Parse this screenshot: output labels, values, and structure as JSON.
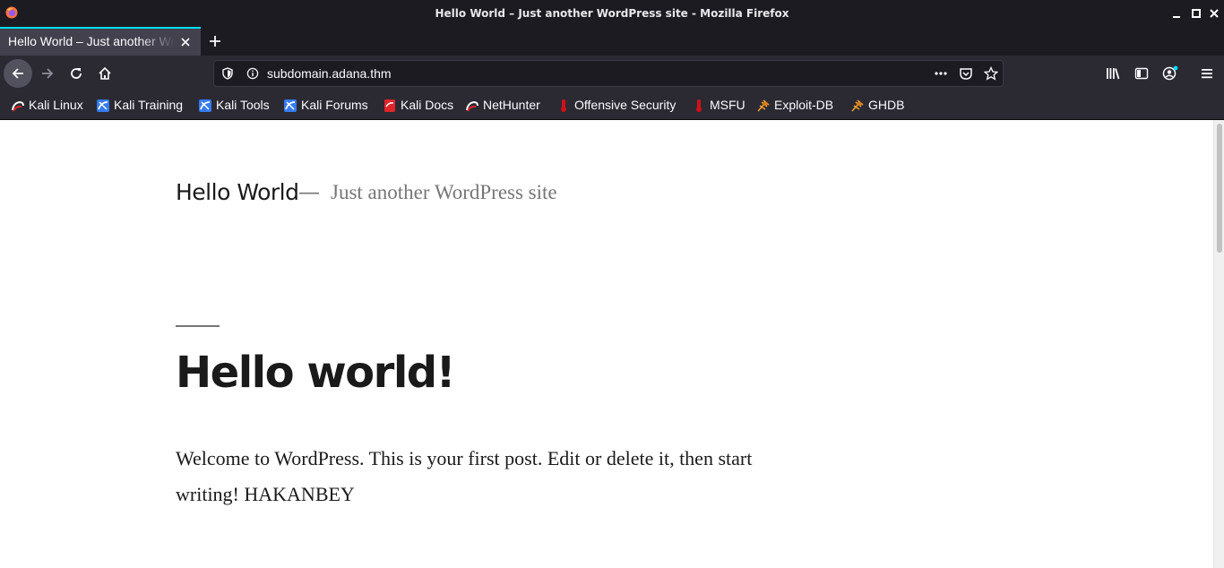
{
  "window": {
    "title": "Hello World – Just another WordPress site - Mozilla Firefox"
  },
  "tab": {
    "label": "Hello World – Just another WordPress site"
  },
  "urlbar": {
    "url": "subdomain.adana.thm"
  },
  "bookmarks": [
    {
      "label": "Kali Linux",
      "icon": "kali-dragon-icon"
    },
    {
      "label": "Kali Training",
      "icon": "kali-training-icon"
    },
    {
      "label": "Kali Tools",
      "icon": "kali-tools-icon"
    },
    {
      "label": "Kali Forums",
      "icon": "kali-forums-icon"
    },
    {
      "label": "Kali Docs",
      "icon": "kali-docs-icon"
    },
    {
      "label": "NetHunter",
      "icon": "nethunter-icon"
    },
    {
      "label": "Offensive Security",
      "icon": "offsec-icon"
    },
    {
      "label": "MSFU",
      "icon": "msfu-icon"
    },
    {
      "label": "Exploit-DB",
      "icon": "exploitdb-icon"
    },
    {
      "label": "GHDB",
      "icon": "ghdb-icon"
    }
  ],
  "site": {
    "title": "Hello World",
    "separator": "—",
    "description": "Just another WordPress site"
  },
  "post": {
    "title": "Hello world!",
    "body": "Welcome to WordPress. This is your first post. Edit or delete it, then start writing! HAKANBEY"
  },
  "colors": {
    "chrome_dark": "#1c1b22",
    "toolbar": "#2b2a33",
    "tab_active": "#42414d",
    "accent": "#00ddff",
    "text_primary": "#1a1a1a",
    "text_muted": "#767676"
  }
}
